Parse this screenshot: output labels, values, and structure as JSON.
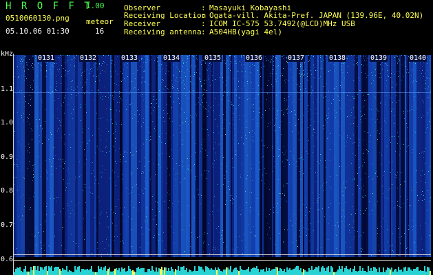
{
  "app": {
    "title": "H R O F F T",
    "version": "1.00"
  },
  "file": {
    "name": "0510060130.png",
    "datetime": "05.10.06 01:30"
  },
  "meteor": {
    "label": "meteor",
    "count": "16"
  },
  "info": [
    {
      "key": "Observer",
      "value": "Masayuki Kobayashi"
    },
    {
      "key": "Receiving Location",
      "value": "Ogata-vill. Akita-Pref. JAPAN (139.96E, 40.02N)"
    },
    {
      "key": "Receiver",
      "value": "ICOM IC-575 53.7492(@LCD)MHz USB"
    },
    {
      "key": "Receiving antenna",
      "value": "A504HB(yagi 4el)"
    }
  ],
  "axis": {
    "unit": "kHz",
    "y_ticks": [
      "1.1",
      "1.0",
      "0.9",
      "0.8",
      "0.7",
      "0.6"
    ],
    "x_ticks": [
      "0131",
      "0132",
      "0133",
      "0134",
      "0135",
      "0136",
      "0137",
      "0138",
      "0139",
      "0140"
    ]
  },
  "colors": {
    "background": "#000000",
    "header_green": "#4cff4c",
    "header_yellow": "#ffff55",
    "spectrum_base": "#0a1a6a",
    "spectrum_signal": "#3fe0ff"
  }
}
